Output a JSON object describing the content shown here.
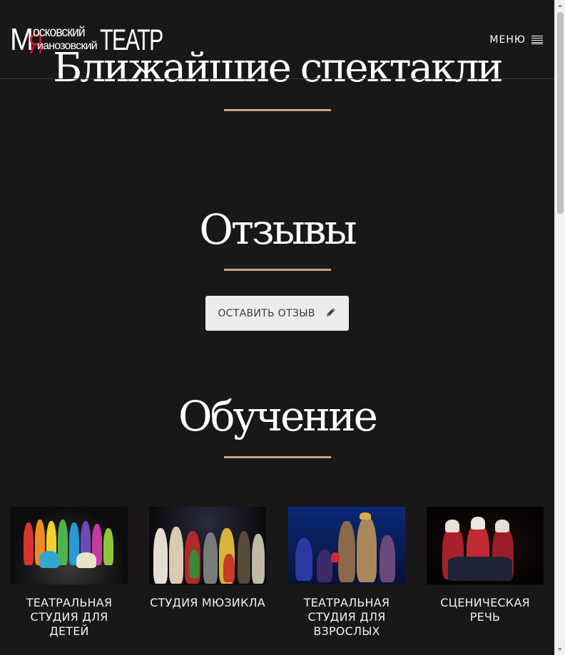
{
  "header": {
    "logo": {
      "line1": "МОСКОВСКИЙ",
      "line2": "ЛИАНОЗОВСКИЙ",
      "line3": "ТЕАТР",
      "text": "МосковскийЛианозовскийТЕАТР"
    },
    "menu_label": "МЕНЮ",
    "menu_icon": "hamburger-icon"
  },
  "sections": {
    "upcoming": {
      "title": "Ближайшие спектакли"
    },
    "reviews": {
      "title": "Отзывы",
      "button_label": "ОСТАВИТЬ ОТЗЫВ",
      "button_icon": "pencil-icon"
    },
    "education": {
      "title": "Обучение",
      "cards": [
        {
          "caption": "ТЕАТРАЛЬНАЯ СТУДИЯ ДЛЯ ДЕТЕЙ"
        },
        {
          "caption": "СТУДИЯ МЮЗИКЛА"
        },
        {
          "caption": "ТЕАТРАЛЬНАЯ СТУДИЯ ДЛЯ ВЗРОСЛЫХ"
        },
        {
          "caption": "СЦЕНИЧЕСКАЯ РЕЧЬ"
        }
      ]
    }
  },
  "colors": {
    "background": "#1a1718",
    "accent_divider": "#c9a582",
    "logo_red": "#d11a2a",
    "button_bg": "#ececec"
  }
}
